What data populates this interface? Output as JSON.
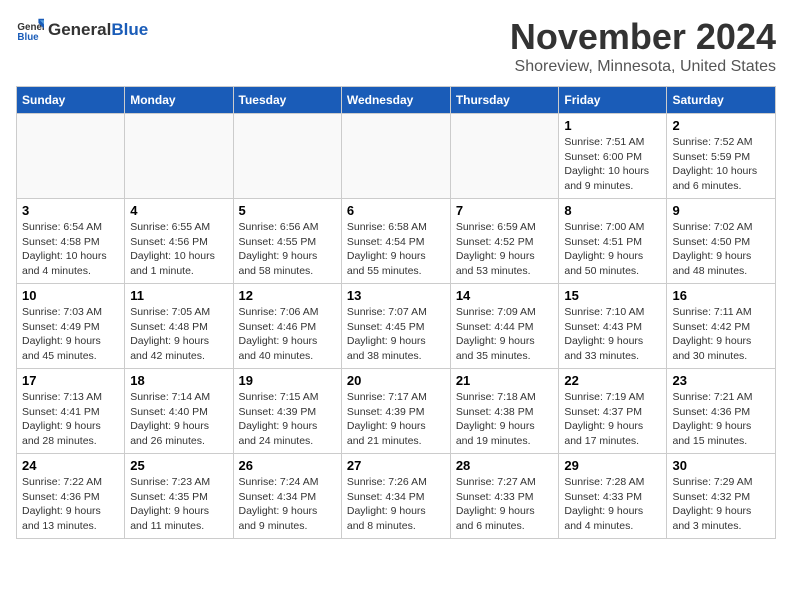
{
  "header": {
    "logo_general": "General",
    "logo_blue": "Blue",
    "month_title": "November 2024",
    "location": "Shoreview, Minnesota, United States"
  },
  "weekdays": [
    "Sunday",
    "Monday",
    "Tuesday",
    "Wednesday",
    "Thursday",
    "Friday",
    "Saturday"
  ],
  "weeks": [
    [
      {
        "day": "",
        "info": ""
      },
      {
        "day": "",
        "info": ""
      },
      {
        "day": "",
        "info": ""
      },
      {
        "day": "",
        "info": ""
      },
      {
        "day": "",
        "info": ""
      },
      {
        "day": "1",
        "info": "Sunrise: 7:51 AM\nSunset: 6:00 PM\nDaylight: 10 hours and 9 minutes."
      },
      {
        "day": "2",
        "info": "Sunrise: 7:52 AM\nSunset: 5:59 PM\nDaylight: 10 hours and 6 minutes."
      }
    ],
    [
      {
        "day": "3",
        "info": "Sunrise: 6:54 AM\nSunset: 4:58 PM\nDaylight: 10 hours and 4 minutes."
      },
      {
        "day": "4",
        "info": "Sunrise: 6:55 AM\nSunset: 4:56 PM\nDaylight: 10 hours and 1 minute."
      },
      {
        "day": "5",
        "info": "Sunrise: 6:56 AM\nSunset: 4:55 PM\nDaylight: 9 hours and 58 minutes."
      },
      {
        "day": "6",
        "info": "Sunrise: 6:58 AM\nSunset: 4:54 PM\nDaylight: 9 hours and 55 minutes."
      },
      {
        "day": "7",
        "info": "Sunrise: 6:59 AM\nSunset: 4:52 PM\nDaylight: 9 hours and 53 minutes."
      },
      {
        "day": "8",
        "info": "Sunrise: 7:00 AM\nSunset: 4:51 PM\nDaylight: 9 hours and 50 minutes."
      },
      {
        "day": "9",
        "info": "Sunrise: 7:02 AM\nSunset: 4:50 PM\nDaylight: 9 hours and 48 minutes."
      }
    ],
    [
      {
        "day": "10",
        "info": "Sunrise: 7:03 AM\nSunset: 4:49 PM\nDaylight: 9 hours and 45 minutes."
      },
      {
        "day": "11",
        "info": "Sunrise: 7:05 AM\nSunset: 4:48 PM\nDaylight: 9 hours and 42 minutes."
      },
      {
        "day": "12",
        "info": "Sunrise: 7:06 AM\nSunset: 4:46 PM\nDaylight: 9 hours and 40 minutes."
      },
      {
        "day": "13",
        "info": "Sunrise: 7:07 AM\nSunset: 4:45 PM\nDaylight: 9 hours and 38 minutes."
      },
      {
        "day": "14",
        "info": "Sunrise: 7:09 AM\nSunset: 4:44 PM\nDaylight: 9 hours and 35 minutes."
      },
      {
        "day": "15",
        "info": "Sunrise: 7:10 AM\nSunset: 4:43 PM\nDaylight: 9 hours and 33 minutes."
      },
      {
        "day": "16",
        "info": "Sunrise: 7:11 AM\nSunset: 4:42 PM\nDaylight: 9 hours and 30 minutes."
      }
    ],
    [
      {
        "day": "17",
        "info": "Sunrise: 7:13 AM\nSunset: 4:41 PM\nDaylight: 9 hours and 28 minutes."
      },
      {
        "day": "18",
        "info": "Sunrise: 7:14 AM\nSunset: 4:40 PM\nDaylight: 9 hours and 26 minutes."
      },
      {
        "day": "19",
        "info": "Sunrise: 7:15 AM\nSunset: 4:39 PM\nDaylight: 9 hours and 24 minutes."
      },
      {
        "day": "20",
        "info": "Sunrise: 7:17 AM\nSunset: 4:39 PM\nDaylight: 9 hours and 21 minutes."
      },
      {
        "day": "21",
        "info": "Sunrise: 7:18 AM\nSunset: 4:38 PM\nDaylight: 9 hours and 19 minutes."
      },
      {
        "day": "22",
        "info": "Sunrise: 7:19 AM\nSunset: 4:37 PM\nDaylight: 9 hours and 17 minutes."
      },
      {
        "day": "23",
        "info": "Sunrise: 7:21 AM\nSunset: 4:36 PM\nDaylight: 9 hours and 15 minutes."
      }
    ],
    [
      {
        "day": "24",
        "info": "Sunrise: 7:22 AM\nSunset: 4:36 PM\nDaylight: 9 hours and 13 minutes."
      },
      {
        "day": "25",
        "info": "Sunrise: 7:23 AM\nSunset: 4:35 PM\nDaylight: 9 hours and 11 minutes."
      },
      {
        "day": "26",
        "info": "Sunrise: 7:24 AM\nSunset: 4:34 PM\nDaylight: 9 hours and 9 minutes."
      },
      {
        "day": "27",
        "info": "Sunrise: 7:26 AM\nSunset: 4:34 PM\nDaylight: 9 hours and 8 minutes."
      },
      {
        "day": "28",
        "info": "Sunrise: 7:27 AM\nSunset: 4:33 PM\nDaylight: 9 hours and 6 minutes."
      },
      {
        "day": "29",
        "info": "Sunrise: 7:28 AM\nSunset: 4:33 PM\nDaylight: 9 hours and 4 minutes."
      },
      {
        "day": "30",
        "info": "Sunrise: 7:29 AM\nSunset: 4:32 PM\nDaylight: 9 hours and 3 minutes."
      }
    ]
  ]
}
